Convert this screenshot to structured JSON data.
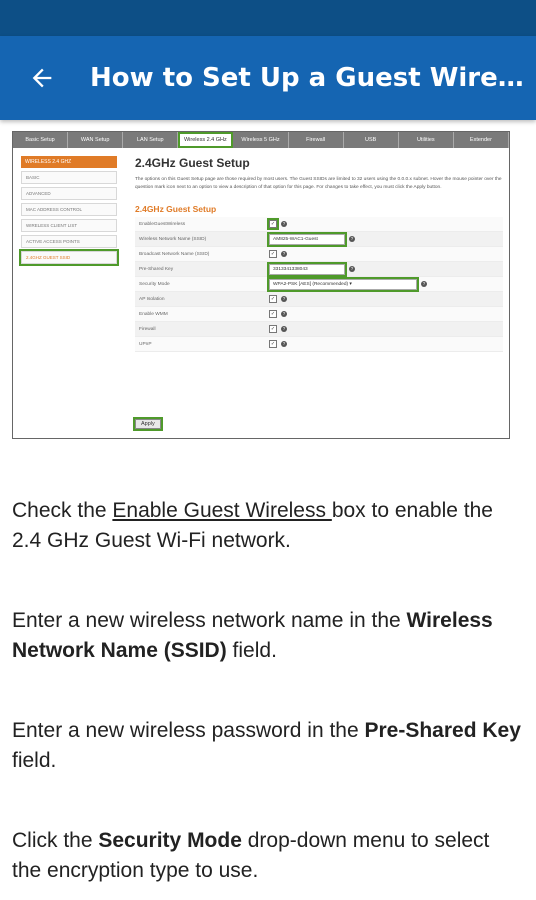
{
  "app": {
    "title": "How to Set Up a Guest Wireless..."
  },
  "router": {
    "nav_tabs": [
      "Basic Setup",
      "WAN Setup",
      "LAN Setup",
      "Wireless 2.4 GHz",
      "Wireless 5 GHz",
      "Firewall",
      "USB",
      "Utilities",
      "Extender"
    ],
    "sidebar": {
      "header": "WIRELESS 2.4 GHZ",
      "items": [
        "BASIC",
        "ADVANCED",
        "MAC ADDRESS CONTROL",
        "WIRELESS CLIENT LIST",
        "ACTIVE ACCESS POINTS",
        "2.4GHZ GUEST SSID"
      ]
    },
    "page_title": "2.4GHz Guest Setup",
    "description": "The options on this Guest Setup page are those required by most users. The Guest SSIDs are limited to 32 users using the 0.0.0.x subnet. Hover the mouse pointer over the question mark icon next to an option to view a description of that option for this page. For changes to take effect, you must click the Apply button.",
    "section_title": "2.4GHz Guest Setup",
    "fields": [
      {
        "label": "EnableGuestWireless",
        "type": "check",
        "checked": true,
        "highlight": true
      },
      {
        "label": "Wireless Network Name (SSID)",
        "type": "text",
        "value": "AM825-WAC1-Guest",
        "highlight": true
      },
      {
        "label": "Broadcast Network Name (SSID)",
        "type": "check",
        "checked": true
      },
      {
        "label": "Pre-Shared Key",
        "type": "text",
        "value": "3313341338043",
        "highlight": true
      },
      {
        "label": "Security Mode",
        "type": "select",
        "value": "WPA2-PSK [AES] (Recommended)",
        "highlight": true
      },
      {
        "label": "AP Isolation",
        "type": "check",
        "checked": true
      },
      {
        "label": "Enable WMM",
        "type": "check",
        "checked": true
      },
      {
        "label": "Firewall",
        "type": "check",
        "checked": true
      },
      {
        "label": "UPnP",
        "type": "check",
        "checked": true
      }
    ],
    "apply_label": "Apply"
  },
  "steps": [
    {
      "parts": [
        {
          "t": "Check the "
        },
        {
          "t": "Enable Guest Wireless ",
          "u": true
        },
        {
          "t": "box to enable the 2.4 GHz Guest Wi-Fi network."
        }
      ]
    },
    {
      "parts": [
        {
          "t": "Enter a new wireless network name in the "
        },
        {
          "t": "Wireless Network Name (SSID)",
          "b": true
        },
        {
          "t": " field."
        }
      ]
    },
    {
      "parts": [
        {
          "t": "Enter a new wireless password in the "
        },
        {
          "t": "Pre-Shared Key",
          "b": true
        },
        {
          "t": " field."
        }
      ]
    },
    {
      "parts": [
        {
          "t": "Click the "
        },
        {
          "t": "Security Mode",
          "b": true
        },
        {
          "t": " drop-down menu to select the encryption type to use."
        }
      ]
    }
  ]
}
